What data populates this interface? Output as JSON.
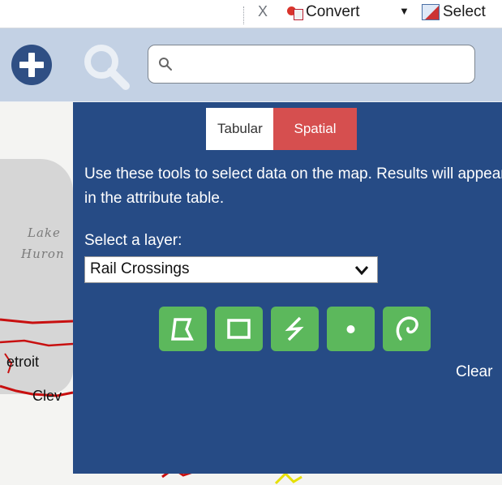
{
  "toolbar": {
    "close_glyph": "X",
    "convert_label": "Convert",
    "convert_caret": "▼",
    "select_label": "Select",
    "icons": [
      "close-icon",
      "convert-pdf-icon",
      "dropdown-caret-icon",
      "select-pdf-icon"
    ]
  },
  "header": {
    "search": {
      "placeholder": "",
      "value": ""
    },
    "icons": [
      "add-icon",
      "search-icon"
    ]
  },
  "map": {
    "labels": {
      "lake_line1": "Lake",
      "lake_line2": "Huron",
      "city1": "etroit",
      "city2": "Clev"
    }
  },
  "panel": {
    "tabs": [
      {
        "label": "Tabular",
        "active": false
      },
      {
        "label": "Spatial",
        "active": true
      }
    ],
    "instructions": "Use these tools to select data on the map. Results will appear in the attribute table.",
    "layer_label": "Select a layer:",
    "layer_selected": "Rail Crossings",
    "tools": [
      {
        "name": "polygon-tool",
        "icon": "polygon-icon"
      },
      {
        "name": "rectangle-tool",
        "icon": "rectangle-icon"
      },
      {
        "name": "line-tool",
        "icon": "line-icon"
      },
      {
        "name": "point-tool",
        "icon": "point-icon"
      },
      {
        "name": "freehand-tool",
        "icon": "freehand-icon"
      }
    ],
    "clear_label": "Clear"
  },
  "colors": {
    "panel_bg": "#264b85",
    "header_bg": "#c3d1e4",
    "tab_active": "#d64f4f",
    "tool_green": "#5cb85c",
    "rail_red": "#c81010"
  }
}
